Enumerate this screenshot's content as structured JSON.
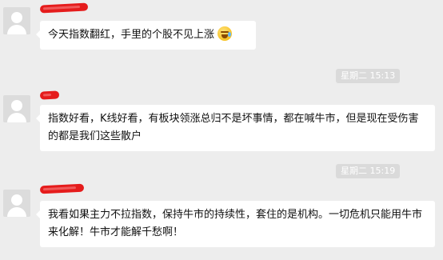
{
  "messages": [
    {
      "text": "今天指数翻红，手里的个股不见上涨",
      "emoji": "crying-laughing-face-icon"
    },
    {
      "text": "指数好看，K线好看，有板块领涨总归不是坏事情，都在喊牛市，但是现在受伤害的都是我们这些散户",
      "timestamp": "星期二 15:13"
    },
    {
      "text": "我看如果主力不拉指数，保持牛市的持续性，套住的是机构。一切危机只能用牛市来化解！牛市才能解千愁啊！",
      "timestamp": "星期二 15:19"
    }
  ]
}
